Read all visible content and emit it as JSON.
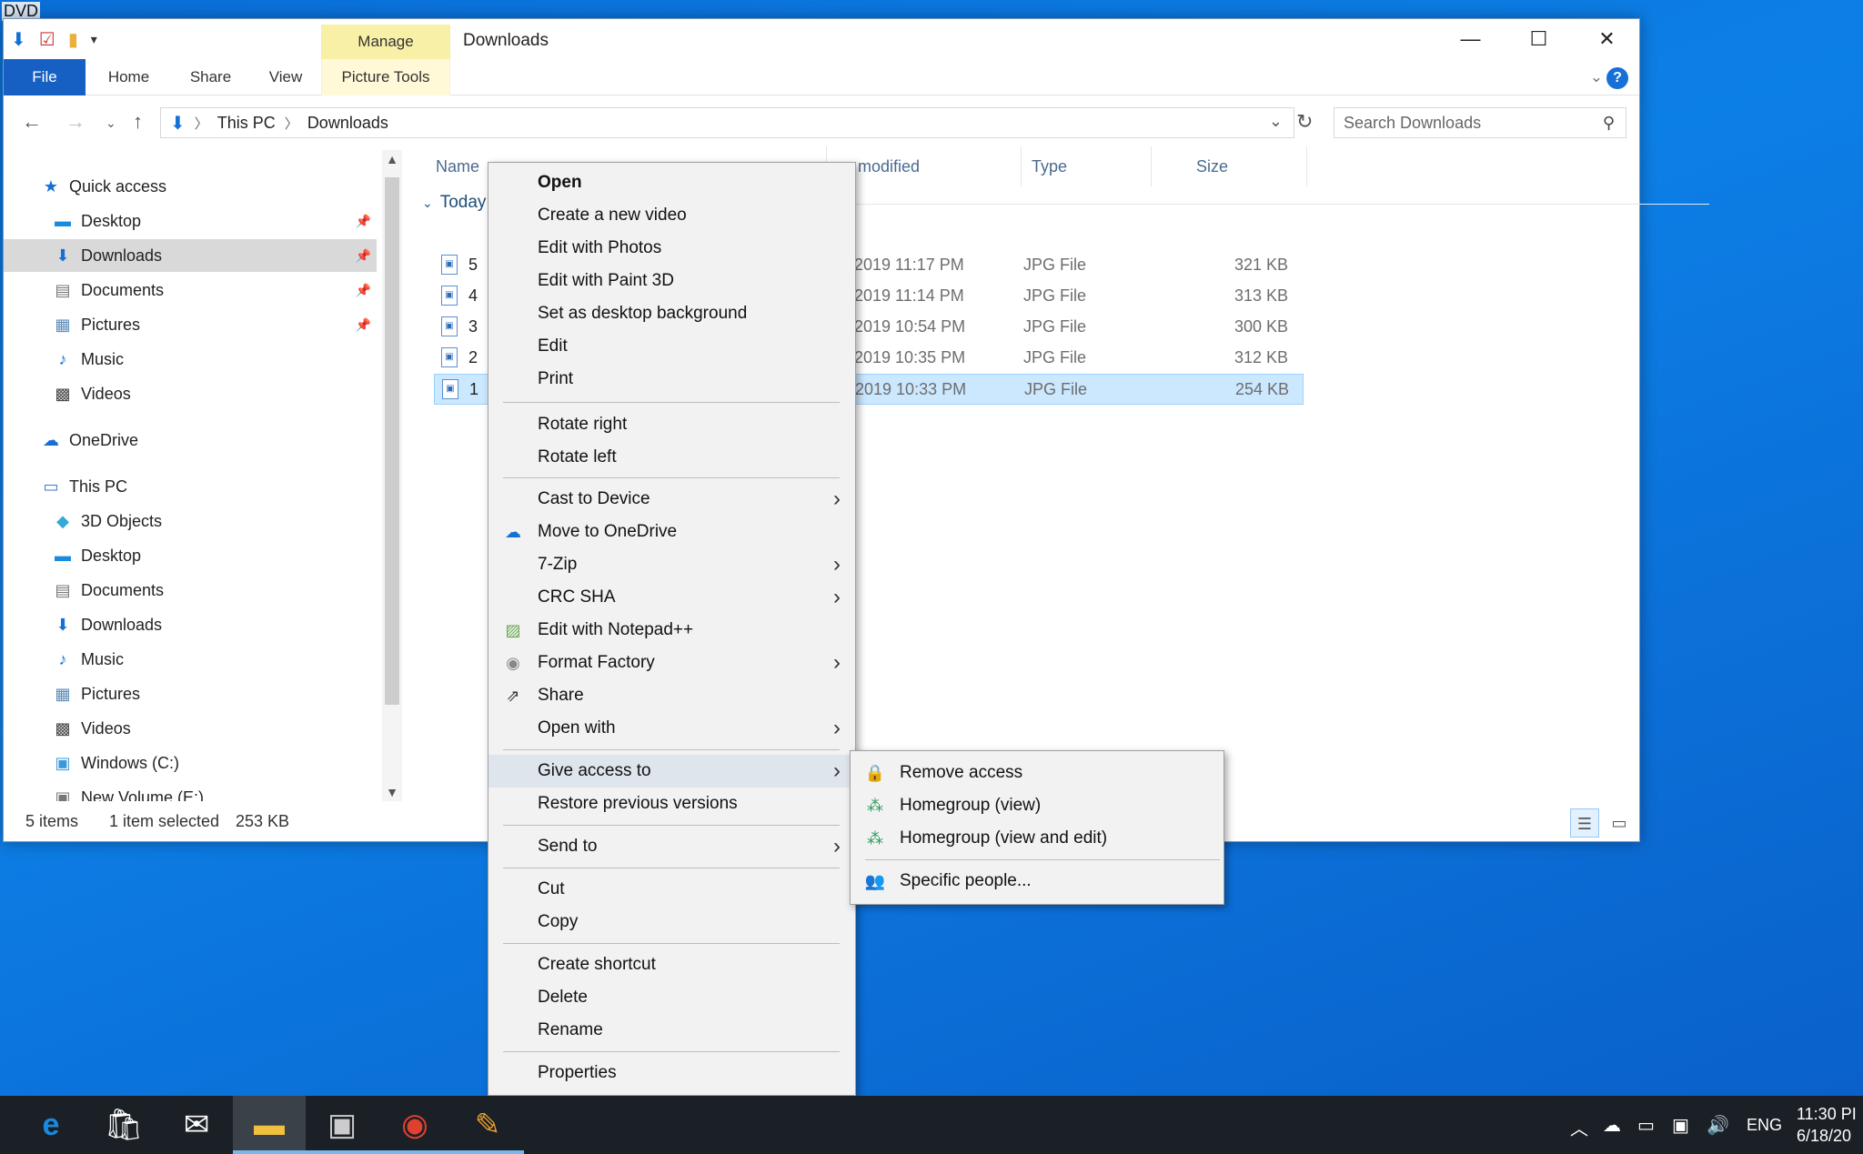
{
  "desktop": {
    "label": "DVD"
  },
  "window": {
    "title": "Downloads",
    "manage_tab": "Manage",
    "ribbon_tabs": [
      "File",
      "Home",
      "Share",
      "View",
      "Picture Tools"
    ],
    "address": {
      "crumbs": [
        "This PC",
        "Downloads"
      ]
    },
    "search_placeholder": "Search Downloads",
    "controls": {
      "minimize": "—",
      "maximize": "☐",
      "close": "✕"
    }
  },
  "nav_pane": {
    "items": [
      {
        "label": "Quick access",
        "icon": "star-icon"
      },
      {
        "label": "Desktop",
        "icon": "desktop-icon"
      },
      {
        "label": "Downloads",
        "icon": "download-icon"
      },
      {
        "label": "Documents",
        "icon": "document-icon"
      },
      {
        "label": "Pictures",
        "icon": "pictures-icon"
      },
      {
        "label": "Music",
        "icon": "music-icon"
      },
      {
        "label": "Videos",
        "icon": "videos-icon"
      },
      {
        "label": "OneDrive",
        "icon": "cloud-icon"
      },
      {
        "label": "This PC",
        "icon": "pc-icon"
      },
      {
        "label": "3D Objects",
        "icon": "cube-icon"
      },
      {
        "label": "Desktop",
        "icon": "desktop-icon"
      },
      {
        "label": "Documents",
        "icon": "document-icon"
      },
      {
        "label": "Downloads",
        "icon": "download-icon"
      },
      {
        "label": "Music",
        "icon": "music-icon"
      },
      {
        "label": "Pictures",
        "icon": "pictures-icon"
      },
      {
        "label": "Videos",
        "icon": "videos-icon"
      },
      {
        "label": "Windows (C:)",
        "icon": "drive-icon"
      },
      {
        "label": "New Volume (E:)",
        "icon": "drive-icon"
      }
    ]
  },
  "file_list": {
    "columns": [
      "Name",
      "modified",
      "Type",
      "Size"
    ],
    "group": "Today",
    "rows": [
      {
        "name": "5",
        "date": "2019 11:17 PM",
        "type": "JPG File",
        "size": "321 KB"
      },
      {
        "name": "4",
        "date": "2019 11:14 PM",
        "type": "JPG File",
        "size": "313 KB"
      },
      {
        "name": "3",
        "date": "2019 10:54 PM",
        "type": "JPG File",
        "size": "300 KB"
      },
      {
        "name": "2",
        "date": "2019 10:35 PM",
        "type": "JPG File",
        "size": "312 KB"
      },
      {
        "name": "1",
        "date": "2019 10:33 PM",
        "type": "JPG File",
        "size": "254 KB",
        "selected": true
      }
    ]
  },
  "status": {
    "items": "5 items",
    "selected": "1 item selected",
    "size": "253 KB"
  },
  "context_menu": {
    "items": [
      {
        "label": "Open"
      },
      {
        "label": "Create a new video"
      },
      {
        "label": "Edit with Photos"
      },
      {
        "label": "Edit with Paint 3D"
      },
      {
        "label": "Set as desktop background"
      },
      {
        "label": "Edit"
      },
      {
        "label": "Print"
      },
      {
        "label": "Rotate right"
      },
      {
        "label": "Rotate left"
      },
      {
        "label": "Cast to Device"
      },
      {
        "label": "Move to OneDrive"
      },
      {
        "label": "7-Zip"
      },
      {
        "label": "CRC SHA"
      },
      {
        "label": "Edit with Notepad++"
      },
      {
        "label": "Format Factory"
      },
      {
        "label": "Share"
      },
      {
        "label": "Open with"
      },
      {
        "label": "Give access to"
      },
      {
        "label": "Restore previous versions"
      },
      {
        "label": "Send to"
      },
      {
        "label": "Cut"
      },
      {
        "label": "Copy"
      },
      {
        "label": "Create shortcut"
      },
      {
        "label": "Delete"
      },
      {
        "label": "Rename"
      },
      {
        "label": "Properties"
      }
    ]
  },
  "submenu": {
    "items": [
      {
        "label": "Remove access"
      },
      {
        "label": "Homegroup (view)"
      },
      {
        "label": "Homegroup (view and edit)"
      },
      {
        "label": "Specific people..."
      }
    ]
  },
  "taskbar": {
    "apps": [
      "edge-icon",
      "store-icon",
      "mail-icon",
      "file-explorer-icon",
      "photos-icon",
      "chrome-icon",
      "paint-icon"
    ],
    "tray_lang": "ENG",
    "time": "11:30 PI",
    "date": "6/18/20"
  },
  "colors": {
    "accent": "#1660c4",
    "selection": "#cce8ff",
    "desktop": "#0a6fd8",
    "manage_tab": "#f9f0a8"
  }
}
